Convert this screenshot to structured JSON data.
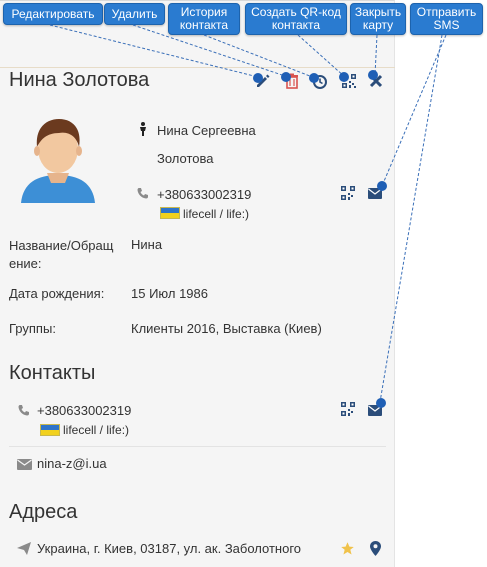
{
  "callouts": {
    "edit": "Редактировать",
    "delete": "Удалить",
    "history_line1": "История",
    "history_line2": "контакта",
    "qr_line1": "Создать QR-код",
    "qr_line2": "контакта",
    "close_card_line1": "Закрыть",
    "close_card_line2": "карту",
    "send_sms_line1": "Отправить",
    "send_sms_line2": "SMS"
  },
  "contact": {
    "name": "Нина Золотова",
    "full_name_line1": "Нина Сергеевна",
    "full_name_line2": "Золотова",
    "phone": "+380633002319",
    "operator": "lifecell / life:)"
  },
  "fields": {
    "salutation_label_line1": "Название/Обращ",
    "salutation_label_line2": "ение:",
    "salutation_value": "Нина",
    "birthday_label": "Дата рождения:",
    "birthday_value": "15 Июл 1986",
    "groups_label": "Группы:",
    "groups_value": "Клиенты 2016, Выставка (Киев)"
  },
  "sections": {
    "contacts_title": "Контакты",
    "addresses_title": "Адреса"
  },
  "contacts": {
    "phone": "+380633002319",
    "operator": "lifecell / life:)",
    "email": "nina-z@i.ua"
  },
  "addresses": {
    "address1": "Украина, г. Киев, 03187, ул. ак. Заболотного"
  },
  "colors": {
    "callout_bg": "#2a7bd0",
    "icon_dark": "#2b4d7a",
    "delete_red": "#d9534f",
    "star": "#f0c24b"
  },
  "icons": [
    "edit-icon",
    "trash-icon",
    "history-icon",
    "qr-icon",
    "close-icon",
    "envelope-icon",
    "phone-icon",
    "person-icon",
    "star-icon",
    "map-pin-icon",
    "paper-plane-icon"
  ]
}
